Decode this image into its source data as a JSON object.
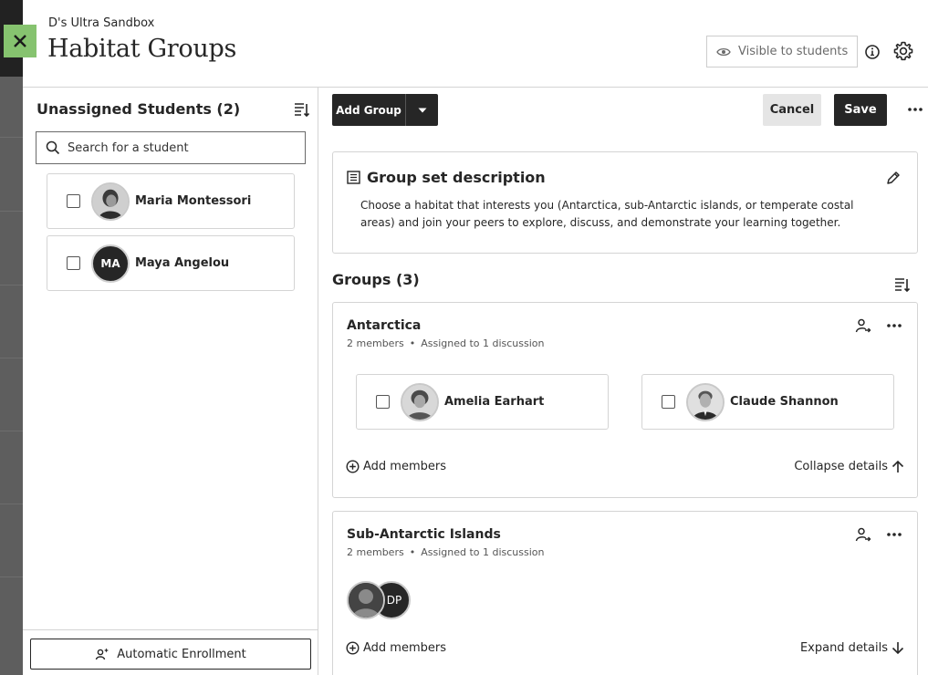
{
  "header": {
    "course_name": "D's Ultra Sandbox",
    "title": "Habitat Groups",
    "visibility_label": "Visible to students"
  },
  "unassigned": {
    "title": "Unassigned Students (2)",
    "search_placeholder": "Search for a student",
    "students": [
      {
        "name": "Maria Montessori",
        "initials": ""
      },
      {
        "name": "Maya Angelou",
        "initials": "MA"
      }
    ],
    "auto_enroll_label": "Automatic Enrollment"
  },
  "toolbar": {
    "add_group_label": "Add Group",
    "cancel_label": "Cancel",
    "save_label": "Save"
  },
  "description": {
    "title": "Group set description",
    "text": "Choose a habitat that interests you (Antarctica, sub-Antarctic islands, or temperate costal areas) and join your peers to explore, discuss, and demonstrate your learning together."
  },
  "groups": {
    "title": "Groups (3)",
    "items": [
      {
        "name": "Antarctica",
        "member_count": "2 members",
        "assignment": "Assigned to 1 discussion",
        "members": [
          {
            "name": "Amelia Earhart"
          },
          {
            "name": "Claude Shannon"
          }
        ],
        "add_members_label": "Add members",
        "toggle_label": "Collapse details"
      },
      {
        "name": "Sub-Antarctic Islands",
        "member_count": "2 members",
        "assignment": "Assigned to 1 discussion",
        "stack_initials": "DP",
        "add_members_label": "Add members",
        "toggle_label": "Expand details"
      }
    ]
  },
  "colors": {
    "close_bg": "#86c36f",
    "primary_dark": "#262626",
    "border": "#d4d4d4"
  }
}
